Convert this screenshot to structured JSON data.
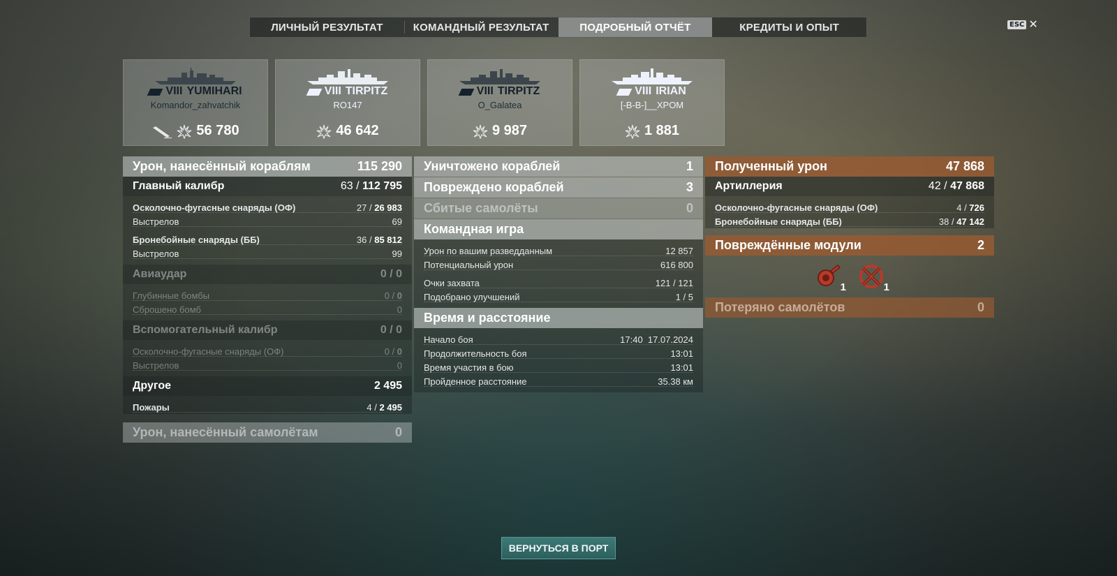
{
  "tabs": [
    "ЛИЧНЫЙ РЕЗУЛЬТАТ",
    "КОМАНДНЫЙ РЕЗУЛЬТАТ",
    "ПОДРОБНЫЙ ОТЧЁТ",
    "КРЕДИТЫ И ОПЫТ"
  ],
  "active_tab": "ПОДРОБНЫЙ ОТЧЁТ",
  "esc": {
    "key": "ESC",
    "close": "✕"
  },
  "cards": [
    {
      "tier": "VIII",
      "ship": "YUMIHARI",
      "player": "Komandor_zahvatchik",
      "damage": "56 780"
    },
    {
      "tier": "VIII",
      "ship": "TIRPITZ",
      "player": "RO147",
      "damage": "46 642"
    },
    {
      "tier": "VIII",
      "ship": "TIRPITZ",
      "player": "O_Galatea",
      "damage": "9 987"
    },
    {
      "tier": "VIII",
      "ship": "IRIAN",
      "player": "[-B-B-]__XPOM",
      "damage": "1 881"
    }
  ],
  "left": {
    "ship_damage": {
      "label": "Урон, нанесённый кораблям",
      "value": "115 290"
    },
    "main_battery": {
      "label": "Главный калибр",
      "hits": "63",
      "value": "112 795"
    },
    "he": {
      "label": "Осколочно-фугасные снаряды (ОФ)",
      "hits": "27",
      "value": "26 983"
    },
    "he_shots": {
      "label": "Выстрелов",
      "value": "69"
    },
    "ap": {
      "label": "Бронебойные снаряды (ББ)",
      "hits": "36",
      "value": "85 812"
    },
    "ap_shots": {
      "label": "Выстрелов",
      "value": "99"
    },
    "airstrike": {
      "label": "Авиаудар",
      "value": "0 / 0"
    },
    "depth_charges": {
      "label": "Глубинные бомбы",
      "hits": "0",
      "value": "0"
    },
    "bombs_dropped": {
      "label": "Сброшено бомб",
      "value": "0"
    },
    "secondary": {
      "label": "Вспомогательный калибр",
      "value": "0 / 0"
    },
    "sec_he": {
      "label": "Осколочно-фугасные снаряды (ОФ)",
      "hits": "0",
      "value": "0"
    },
    "sec_shots": {
      "label": "Выстрелов",
      "value": "0"
    },
    "other": {
      "label": "Другое",
      "value": "2 495"
    },
    "fires": {
      "label": "Пожары",
      "hits": "4",
      "value": "2 495"
    },
    "plane_damage": {
      "label": "Урон, нанесённый самолётам",
      "value": "0"
    }
  },
  "middle": {
    "destroyed": {
      "label": "Уничтожено кораблей",
      "value": "1"
    },
    "damaged": {
      "label": "Повреждено кораблей",
      "value": "3"
    },
    "planes_shot": {
      "label": "Сбитые самолёты",
      "value": "0"
    },
    "team_play": {
      "label": "Командная игра"
    },
    "spotting": {
      "label": "Урон по вашим разведданным",
      "value": "12 857"
    },
    "potential": {
      "label": "Потенциальный урон",
      "value": "616 800"
    },
    "capture": {
      "label": "Очки захвата",
      "value": "121 / 121"
    },
    "upgrades": {
      "label": "Подобрано улучшений",
      "value": "1 / 5"
    },
    "time_distance": {
      "label": "Время и расстояние"
    },
    "start": {
      "label": "Начало боя",
      "value": "17:40  17.07.2024"
    },
    "duration": {
      "label": "Продолжительность боя",
      "value": "13:01"
    },
    "participation": {
      "label": "Время участия в бою",
      "value": "13:01"
    },
    "distance": {
      "label": "Пройденное расстояние",
      "value": "35.38 км"
    }
  },
  "right": {
    "received": {
      "label": "Полученный урон",
      "value": "47 868"
    },
    "artillery": {
      "label": "Артиллерия",
      "hits": "42",
      "value": "47 868"
    },
    "he": {
      "label": "Осколочно-фугасные снаряды (ОФ)",
      "hits": "4",
      "value": "726"
    },
    "ap": {
      "label": "Бронебойные снаряды (ББ)",
      "hits": "38",
      "value": "47 142"
    },
    "modules": {
      "label": "Повреждённые модули",
      "value": "2",
      "items": [
        {
          "icon": "ammo-module-icon",
          "count": "1"
        },
        {
          "icon": "steering-module-icon",
          "count": "1"
        }
      ]
    },
    "planes_lost": {
      "label": "Потеряно самолётов",
      "value": "0"
    }
  },
  "return_button": "ВЕРНУТЬСЯ В ПОРТ",
  "colors": {
    "accent_orange": "#965a32",
    "button_teal": "#2b5f5e",
    "dark_ship": "#15212c",
    "light_ship": "#eef2ff"
  }
}
